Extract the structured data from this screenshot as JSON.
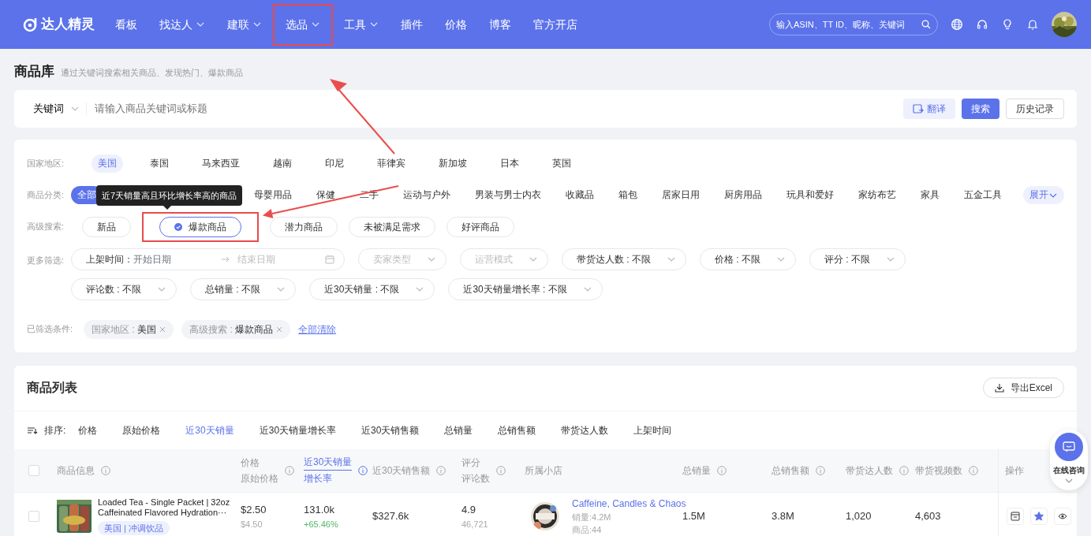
{
  "navbar": {
    "logo": "达人精灵",
    "items": [
      {
        "label": "看板",
        "dropdown": false,
        "highlighted": false
      },
      {
        "label": "找达人",
        "dropdown": true,
        "highlighted": false
      },
      {
        "label": "建联",
        "dropdown": true,
        "highlighted": false
      },
      {
        "label": "选品",
        "dropdown": true,
        "highlighted": true
      },
      {
        "label": "工具",
        "dropdown": true,
        "highlighted": false
      },
      {
        "label": "插件",
        "dropdown": false,
        "highlighted": false
      },
      {
        "label": "价格",
        "dropdown": false,
        "highlighted": false
      },
      {
        "label": "博客",
        "dropdown": false,
        "highlighted": false
      },
      {
        "label": "官方开店",
        "dropdown": false,
        "highlighted": false
      }
    ],
    "search": {
      "placeholder": "输入ASIN、TT ID、昵称、关键词"
    }
  },
  "page": {
    "title": "商品库",
    "subtitle": "通过关键词搜索相关商品、发现热门、爆款商品"
  },
  "keyword_search": {
    "type": "关键词",
    "placeholder": "请输入商品关键词或标题",
    "buttons": [
      {
        "label": "翻译",
        "kind": "light"
      },
      {
        "label": "搜索",
        "kind": "primary"
      },
      {
        "label": "历史记录",
        "kind": "outline"
      }
    ]
  },
  "filters": {
    "country": {
      "label": "国家地区:",
      "options": [
        {
          "label": "美国",
          "selected": true
        },
        {
          "label": "泰国",
          "selected": false
        },
        {
          "label": "马来西亚",
          "selected": false
        },
        {
          "label": "越南",
          "selected": false
        },
        {
          "label": "印尼",
          "selected": false
        },
        {
          "label": "菲律宾",
          "selected": false
        },
        {
          "label": "新加坡",
          "selected": false
        },
        {
          "label": "日本",
          "selected": false
        },
        {
          "label": "英国",
          "selected": false
        }
      ]
    },
    "category": {
      "label": "商品分类:",
      "options": [
        {
          "label": "全部",
          "selected": true
        },
        {
          "label": "母婴用品",
          "selected": false
        },
        {
          "label": "保健",
          "selected": false
        },
        {
          "label": "二手",
          "selected": false
        },
        {
          "label": "运动与户外",
          "selected": false
        },
        {
          "label": "男装与男士内衣",
          "selected": false
        },
        {
          "label": "收藏品",
          "selected": false
        },
        {
          "label": "箱包",
          "selected": false
        },
        {
          "label": "居家日用",
          "selected": false
        },
        {
          "label": "厨房用品",
          "selected": false
        },
        {
          "label": "玩具和爱好",
          "selected": false
        },
        {
          "label": "家纺布艺",
          "selected": false
        },
        {
          "label": "家具",
          "selected": false
        },
        {
          "label": "五金工具",
          "selected": false
        }
      ],
      "expand": "展开"
    },
    "advanced": {
      "label": "高级搜索:",
      "options": [
        {
          "label": "新品",
          "selected": false,
          "highlighted": false
        },
        {
          "label": "爆款商品",
          "selected": true,
          "highlighted": true
        },
        {
          "label": "潜力商品",
          "selected": false,
          "highlighted": false
        },
        {
          "label": "未被满足需求",
          "selected": false,
          "highlighted": false
        },
        {
          "label": "好评商品",
          "selected": false,
          "highlighted": false
        }
      ],
      "tooltip": "近7天销量高且环比增长率高的商品"
    },
    "more": {
      "label": "更多筛选:",
      "fields": [
        {
          "kind": "date_range",
          "label": "上架时间：",
          "start_placeholder": "开始日期",
          "end_placeholder": "结束日期"
        },
        {
          "kind": "select",
          "label": "卖家类型",
          "muted": true
        },
        {
          "kind": "select",
          "label": "运营模式",
          "muted": true
        },
        {
          "kind": "select",
          "label": "带货达人数 : 不限",
          "muted": false
        },
        {
          "kind": "select",
          "label": "价格 : 不限",
          "muted": false
        },
        {
          "kind": "select",
          "label": "评分 : 不限",
          "muted": false
        },
        {
          "kind": "select",
          "label": "评论数 : 不限",
          "muted": false
        },
        {
          "kind": "select",
          "label": "总销量 : 不限",
          "muted": false
        },
        {
          "kind": "select",
          "label": "近30天销量 : 不限",
          "muted": false
        },
        {
          "kind": "select",
          "label": "近30天销量增长率 : 不限",
          "muted": false
        }
      ]
    },
    "applied": {
      "label": "已筛选条件:",
      "tags": [
        {
          "name": "国家地区 : ",
          "value": "美国"
        },
        {
          "name": "高级搜索 : ",
          "value": "爆款商品"
        }
      ],
      "clear": "全部清除"
    }
  },
  "product_list": {
    "title": "商品列表",
    "select_all_checked": false,
    "export": "导出Excel",
    "sort": {
      "label": "排序:",
      "options": [
        {
          "label": "价格",
          "selected": false
        },
        {
          "label": "原始价格",
          "selected": false
        },
        {
          "label": "近30天销量",
          "selected": true
        },
        {
          "label": "近30天销量增长率",
          "selected": false
        },
        {
          "label": "近30天销售额",
          "selected": false
        },
        {
          "label": "总销量",
          "selected": false
        },
        {
          "label": "总销售额",
          "selected": false
        },
        {
          "label": "带货达人数",
          "selected": false
        },
        {
          "label": "上架时间",
          "selected": false
        }
      ]
    },
    "columns": [
      {
        "lines": [
          "商品信息"
        ],
        "info": true,
        "selected": false
      },
      {
        "lines": [
          "价格",
          "原始价格"
        ],
        "info": true,
        "selected": false
      },
      {
        "lines": [
          "近30天销量",
          "增长率"
        ],
        "info": true,
        "selected": true
      },
      {
        "lines": [
          "近30天销售额"
        ],
        "info": true,
        "selected": false
      },
      {
        "lines": [
          "评分",
          "评论数"
        ],
        "info": true,
        "selected": false
      },
      {
        "lines": [
          "所属小店"
        ],
        "info": false,
        "selected": false
      },
      {
        "lines": [
          "总销量"
        ],
        "info": true,
        "selected": false
      },
      {
        "lines": [
          "总销售额"
        ],
        "info": true,
        "selected": false
      },
      {
        "lines": [
          "带货达人数"
        ],
        "info": true,
        "selected": false
      },
      {
        "lines": [
          "带货视频数"
        ],
        "info": true,
        "selected": false
      },
      {
        "lines": [
          "操作"
        ],
        "info": false,
        "selected": false
      }
    ],
    "rows": [
      {
        "checked": false,
        "title": "Loaded Tea - Single Packet | 32oz Caffeinated Flavored Hydration···",
        "tag": "美国 | 冲调饮品",
        "price": "$2.50",
        "original_price": "$4.50",
        "sales_30d": "131.0k",
        "growth": "+65.46%",
        "revenue_30d": "$327.6k",
        "rating": "4.9",
        "reviews": "46,721",
        "shop": {
          "name": "Caffeine, Candles & Chaos",
          "sales": "销量:4.2M",
          "products": "商品:44"
        },
        "total_sales": "1.5M",
        "total_revenue": "3.8M",
        "creators": "1,020",
        "videos": "4,603",
        "favorited": true
      }
    ]
  },
  "chat_widget": {
    "label": "在线咨询"
  }
}
